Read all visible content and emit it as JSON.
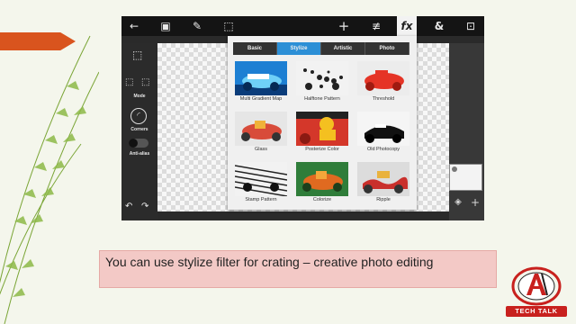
{
  "slide": {
    "caption": "You can use stylize filter for crating – creative photo editing",
    "logo": {
      "letter": "A",
      "text": "TECH TALK"
    },
    "accent": "#d9541e"
  },
  "app": {
    "topbar_icons": [
      "back-arrow-icon",
      "add-image-icon",
      "brush-icon",
      "selection-icon",
      "plus-icon",
      "adjust-icon",
      "fx-icon",
      "ampersand-icon",
      "fit-screen-icon"
    ],
    "fx_label": "fx",
    "left_tools": {
      "mode_label": "Mode",
      "corners_label": "Corners",
      "antialias_label": "Anti-alias"
    },
    "filter_panel": {
      "tabs": [
        {
          "label": "Basic",
          "selected": false
        },
        {
          "label": "Stylize",
          "selected": true
        },
        {
          "label": "Artistic",
          "selected": false
        },
        {
          "label": "Photo",
          "selected": false
        }
      ],
      "filters": [
        {
          "label": "Multi Gradient Map"
        },
        {
          "label": "Halftone Pattern"
        },
        {
          "label": "Threshold"
        },
        {
          "label": "Glass"
        },
        {
          "label": "Posterize Color"
        },
        {
          "label": "Old Photocopy"
        },
        {
          "label": "Stamp Pattern"
        },
        {
          "label": "Colorize"
        },
        {
          "label": "Ripple"
        }
      ],
      "selected_color": "#2c8fd6"
    }
  }
}
